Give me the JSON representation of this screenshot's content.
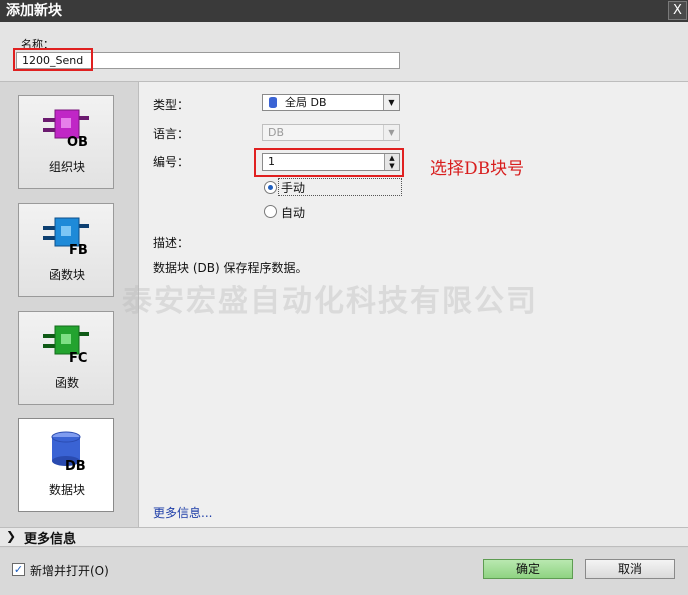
{
  "window": {
    "title": "添加新块",
    "close_glyph": "X"
  },
  "name": {
    "label": "名称：",
    "value": "1200_Send"
  },
  "palette": [
    {
      "id": "ob",
      "code": "OB",
      "label": "组织块",
      "color": "#c026c6"
    },
    {
      "id": "fb",
      "code": "FB",
      "label": "函数块",
      "color": "#1e8ad8"
    },
    {
      "id": "fc",
      "code": "FC",
      "label": "函数",
      "color": "#23a32f"
    },
    {
      "id": "db",
      "code": "DB",
      "label": "数据块",
      "color": "#3a63d4",
      "selected": true
    }
  ],
  "form": {
    "type_label": "类型：",
    "type_value": "全局 DB",
    "language_label": "语言：",
    "language_value": "DB",
    "number_label": "编号：",
    "number_value": "1",
    "radio_manual": "手动",
    "radio_auto": "自动",
    "radio_selected": "manual",
    "description_label": "描述：",
    "description_text": "数据块 (DB) 保存程序数据。",
    "more_info_link": "更多信息..."
  },
  "annotation": "选择DB块号",
  "watermark": "泰安宏盛自动化科技有限公司",
  "more_info_bar": {
    "label": "更多信息"
  },
  "footer": {
    "add_and_open_label": "新增并打开(O)",
    "add_and_open_checked": true,
    "ok_label": "确定",
    "cancel_label": "取消"
  },
  "colors": {
    "highlight_red": "#e02020",
    "ok_green": "#8fd382",
    "link_blue": "#1f3fa8"
  }
}
